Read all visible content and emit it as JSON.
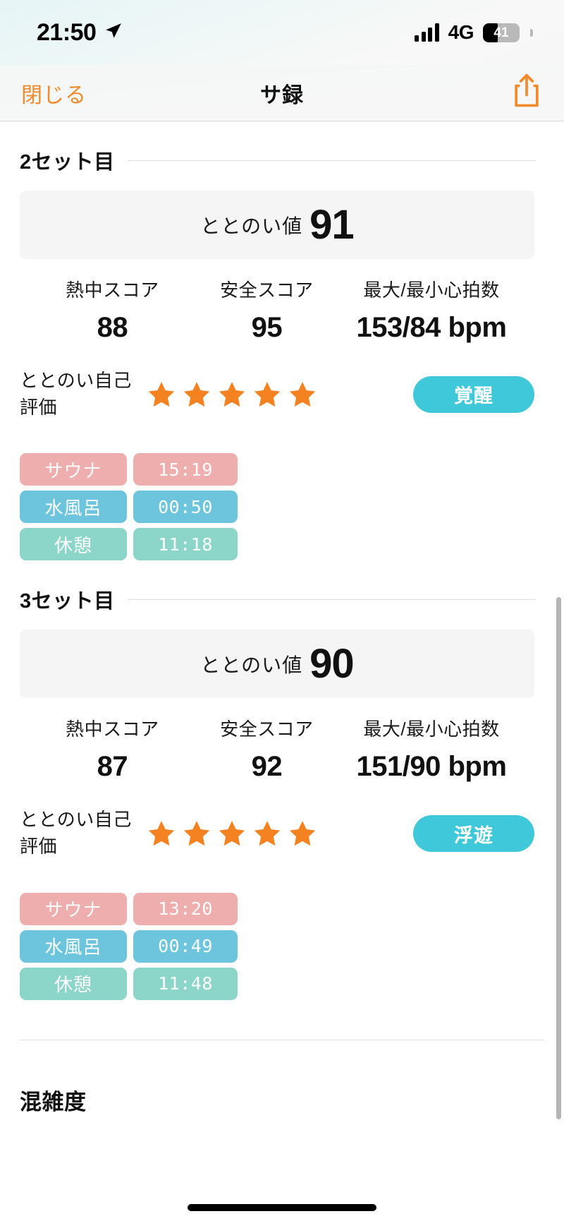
{
  "status_bar": {
    "time": "21:50",
    "location_icon": "location-arrow-icon",
    "network": "4G",
    "signal_icon": "cellular-bars-icon",
    "battery_percent": "41",
    "battery_level": 41
  },
  "nav": {
    "close_label": "閉じる",
    "title": "サ録",
    "share_icon": "share-icon",
    "accent_color": "#f08a2a"
  },
  "sets": [
    {
      "heading": "2セット目",
      "score": {
        "label": "ととのい値",
        "value": "91"
      },
      "stats": [
        {
          "label": "熱中スコア",
          "value": "88"
        },
        {
          "label": "安全スコア",
          "value": "95"
        },
        {
          "label": "最大/最小心拍数",
          "value": "153/84 bpm"
        }
      ],
      "rating": {
        "label": "ととのい自己評価",
        "stars": 5,
        "star_color": "#f58220"
      },
      "badge": {
        "text": "覚醒",
        "color": "#3ec8da"
      },
      "phases": [
        {
          "name": "サウナ",
          "time": "15:19",
          "color": "#eeaeae"
        },
        {
          "name": "水風呂",
          "time": "00:50",
          "color": "#6cc5dd"
        },
        {
          "name": "休憩",
          "time": "11:18",
          "color": "#8bd6c8"
        }
      ]
    },
    {
      "heading": "3セット目",
      "score": {
        "label": "ととのい値",
        "value": "90"
      },
      "stats": [
        {
          "label": "熱中スコア",
          "value": "87"
        },
        {
          "label": "安全スコア",
          "value": "92"
        },
        {
          "label": "最大/最小心拍数",
          "value": "151/90 bpm"
        }
      ],
      "rating": {
        "label": "ととのい自己評価",
        "stars": 5,
        "star_color": "#f58220"
      },
      "badge": {
        "text": "浮遊",
        "color": "#3ec8da"
      },
      "phases": [
        {
          "name": "サウナ",
          "time": "13:20",
          "color": "#eeaeae"
        },
        {
          "name": "水風呂",
          "time": "00:49",
          "color": "#6cc5dd"
        },
        {
          "name": "休憩",
          "time": "11:48",
          "color": "#8bd6c8"
        }
      ]
    }
  ],
  "bottom": {
    "section_title": "混雑度",
    "home_indicator": "home-indicator"
  }
}
